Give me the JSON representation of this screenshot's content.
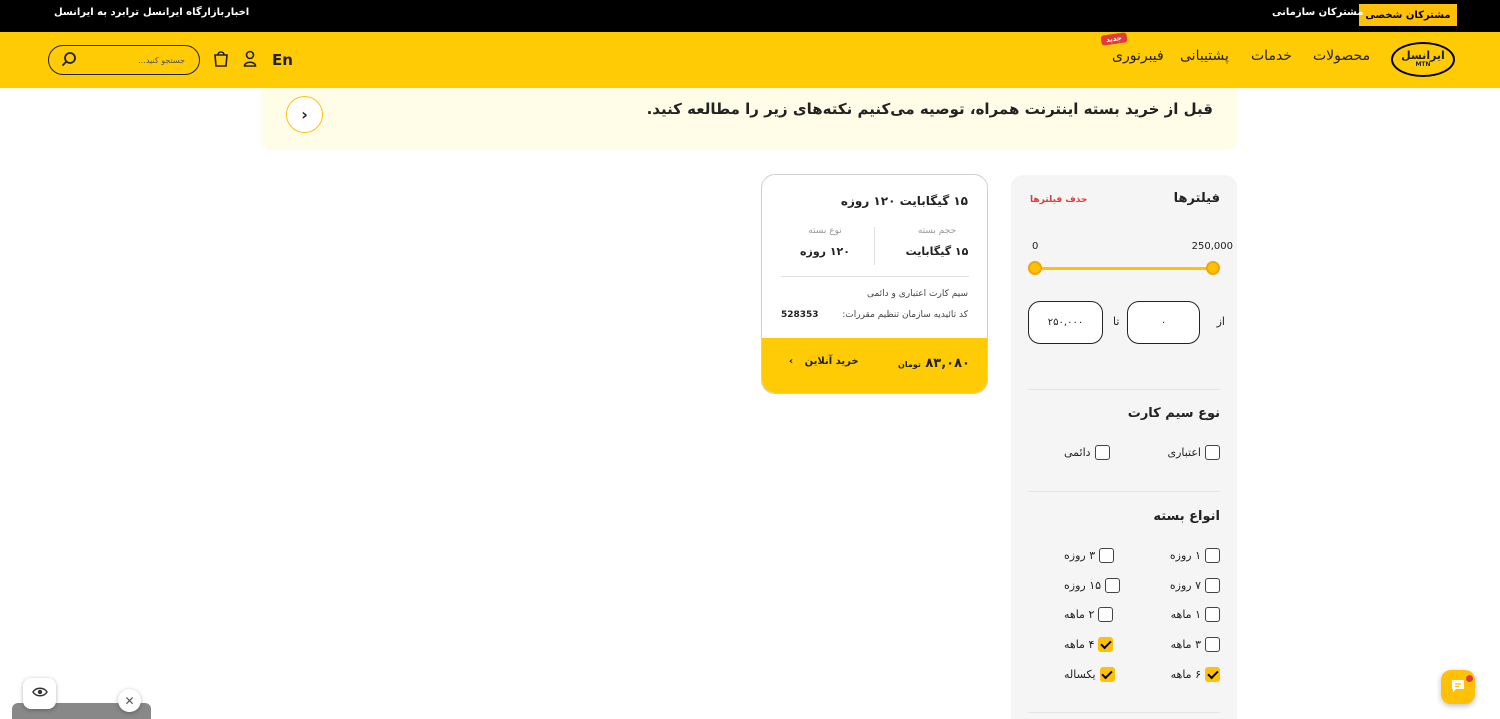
{
  "topbar": {
    "personal": "مشترکان شخصی",
    "business": "مشترکان سازمانی",
    "news": "اخبار",
    "marketplace": "بازارگاه ایرانسل",
    "trabord": "ترابرد به ایرانسل"
  },
  "header": {
    "logo_line1": "ایرانسل",
    "logo_line2": "MTN",
    "nav": [
      "محصولات",
      "خدمات",
      "پشتیبانی",
      "فیبرنوری"
    ],
    "new_badge": "جدید",
    "lang": "En",
    "search_placeholder": "جستجو کنید..."
  },
  "notice": {
    "text": "قبل از خرید بسته اینترنت همراه، توصیه می‌کنیم نکته‌های زیر را مطالعه کنید."
  },
  "filters": {
    "title": "فیلترها",
    "clear": "حذف فیلترها",
    "range_min_label": "0",
    "range_max_label": "250,000",
    "from_word": "از",
    "to_word": "تا",
    "from_value": "۰",
    "to_value": "۲۵۰,۰۰۰",
    "sim_title": "نوع سیم کارت",
    "sim_options": [
      {
        "label": "اعتباری",
        "checked": false
      },
      {
        "label": "دائمی",
        "checked": false
      }
    ],
    "pkg_title": "انواع بسته",
    "pkg_options": [
      {
        "label": "۱ روزه",
        "checked": false
      },
      {
        "label": "۳ روزه",
        "checked": false
      },
      {
        "label": "۷ روزه",
        "checked": false
      },
      {
        "label": "۱۵ روزه",
        "checked": false
      },
      {
        "label": "۱ ماهه",
        "checked": false
      },
      {
        "label": "۲ ماهه",
        "checked": false
      },
      {
        "label": "۳ ماهه",
        "checked": false
      },
      {
        "label": "۴ ماهه",
        "checked": true
      },
      {
        "label": "۶ ماهه",
        "checked": true
      },
      {
        "label": "یکساله",
        "checked": true
      }
    ]
  },
  "card": {
    "title": "۱۵ گیگابایت ۱۲۰ روزه",
    "volume_label": "حجم بسته",
    "volume_value": "۱۵ گیگابایت",
    "type_label": "نوع بسته",
    "type_value": "۱۲۰ روزه",
    "sim_text": "سیم کارت اعتباری و دائمی",
    "code_label": "کد تائیدیه سازمان تنظیم مقررات:",
    "code_value": "528353",
    "price": "۸۳,۰۸۰",
    "currency": "تومان",
    "buy": "خرید آنلاین"
  },
  "colors": {
    "brand_yellow": "#ffcb05",
    "accent_red": "#e53935"
  }
}
